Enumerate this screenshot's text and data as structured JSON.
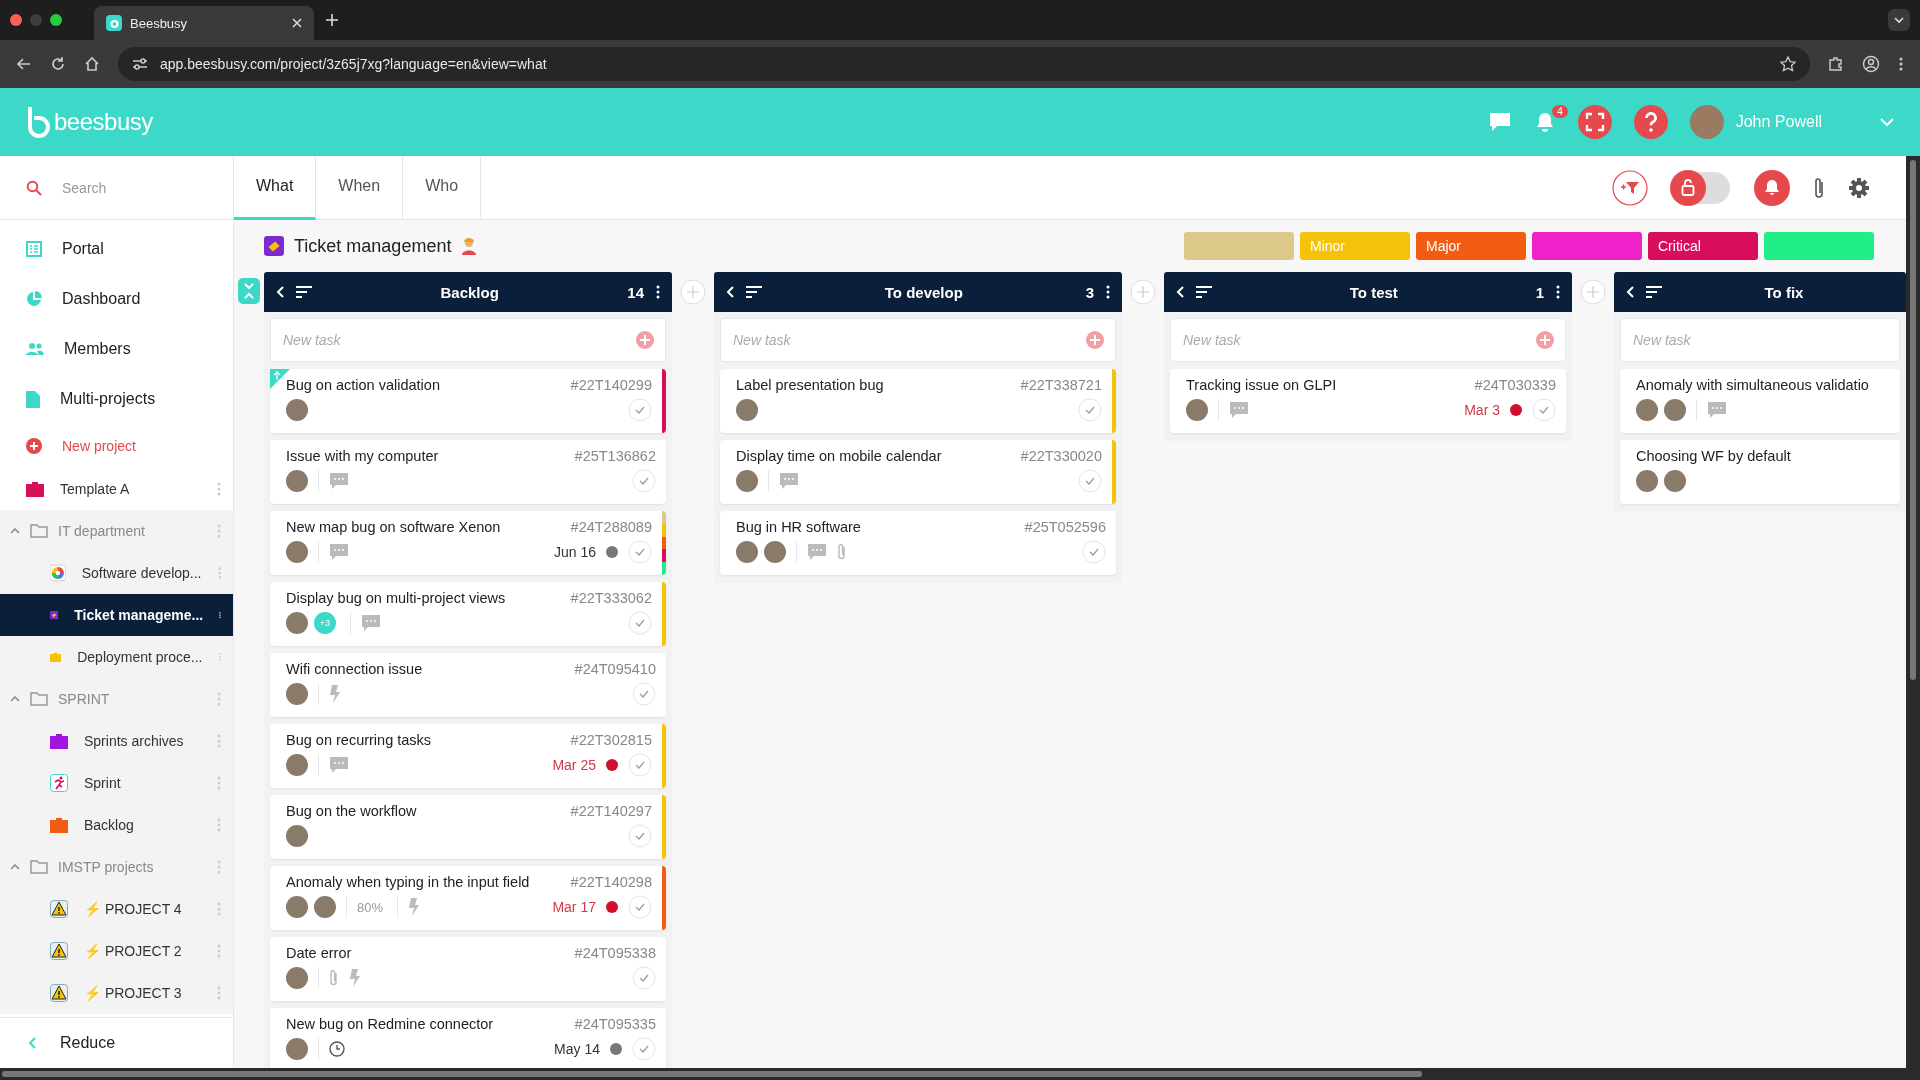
{
  "browser": {
    "tab_title": "Beesbusy",
    "url": "app.beesbusy.com/project/3z65j7xg?language=en&view=what"
  },
  "header": {
    "logo": "beesbusy",
    "notification_count": "4",
    "user_name": "John Powell"
  },
  "sidebar": {
    "search": {
      "placeholder": "Search"
    },
    "nav": [
      {
        "label": "Portal",
        "kind": "portal"
      },
      {
        "label": "Dashboard",
        "kind": "dashboard"
      },
      {
        "label": "Members",
        "kind": "members"
      },
      {
        "label": "Multi-projects",
        "kind": "multi"
      },
      {
        "label": "New project",
        "kind": "new"
      }
    ],
    "tree": [
      {
        "kind": "project",
        "label": "Template A",
        "color": "#d6105a",
        "selected": false
      },
      {
        "kind": "group",
        "label": "IT department",
        "expanded": true,
        "children": [
          {
            "label": "Software develop...",
            "kind": "wheel",
            "selected": false
          },
          {
            "label": "Ticket manageme...",
            "kind": "ticket",
            "selected": true
          },
          {
            "label": "Deployment proce...",
            "kind": "briefcase",
            "color": "#f5c20b",
            "selected": false
          }
        ]
      },
      {
        "kind": "group",
        "label": "SPRINT",
        "expanded": true,
        "children": [
          {
            "label": "Sprints archives",
            "kind": "briefcase",
            "color": "#a314e0",
            "selected": false
          },
          {
            "label": "Sprint",
            "kind": "runner",
            "selected": false
          },
          {
            "label": "Backlog",
            "kind": "briefcase",
            "color": "#f25c12",
            "selected": false
          }
        ]
      },
      {
        "kind": "group",
        "label": "IMSTP projects",
        "expanded": true,
        "children": [
          {
            "label": "⚡ PROJECT 4",
            "kind": "warning",
            "selected": false
          },
          {
            "label": "⚡ PROJECT 2",
            "kind": "warning",
            "selected": false
          },
          {
            "label": "⚡ PROJECT 3",
            "kind": "warning",
            "selected": false
          }
        ]
      }
    ],
    "reduce": "Reduce"
  },
  "view_tabs": [
    {
      "label": "What",
      "selected": true
    },
    {
      "label": "When",
      "selected": false
    },
    {
      "label": "Who",
      "selected": false
    }
  ],
  "board": {
    "title": "Ticket management"
  },
  "labels": [
    {
      "color": "#dcc98a"
    },
    {
      "text": "Minor",
      "color": "#f5c20b"
    },
    {
      "text": "Major",
      "color": "#f25c12"
    },
    {
      "color": "#ee22c8"
    },
    {
      "text": "Critical",
      "color": "#d80d5b"
    },
    {
      "color": "#22ee88"
    }
  ],
  "columns": [
    {
      "title": "Backlog",
      "count": "14",
      "placeholder": "New task",
      "tasks": [
        {
          "title": "Bug on action validation",
          "id": "#22T140299",
          "flagged": true,
          "avatars": [
            {
              "kind": "person"
            }
          ],
          "stripes": [
            {
              "color": "#d80d5b"
            }
          ]
        },
        {
          "title": "Issue with my computer",
          "id": "#25T136862",
          "avatars": [
            {
              "kind": "person"
            }
          ],
          "icons": [
            {
              "kind": "comment"
            }
          ]
        },
        {
          "title": "New map bug on software Xenon",
          "id": "#24T288089",
          "avatars": [
            {
              "kind": "person"
            }
          ],
          "icons": [
            {
              "kind": "comment"
            }
          ],
          "due": "Jun 16",
          "overdue": false,
          "stripes": [
            {
              "color": "#dcc98a"
            },
            {
              "color": "#f5c20b"
            },
            {
              "color": "#f25c12"
            },
            {
              "color": "#d80d5b"
            },
            {
              "color": "#22ee88"
            }
          ]
        },
        {
          "title": "Display bug on multi-project views",
          "id": "#22T333062",
          "avatars": [
            {
              "kind": "person"
            },
            {
              "kind": "more",
              "text": "+3"
            }
          ],
          "icons": [
            {
              "kind": "comment"
            }
          ],
          "stripes": [
            {
              "color": "#f5c20b"
            }
          ]
        },
        {
          "title": "Wifi connection issue",
          "id": "#24T095410",
          "avatars": [
            {
              "kind": "person"
            }
          ],
          "icons": [
            {
              "kind": "bolt"
            }
          ]
        },
        {
          "title": "Bug on recurring tasks",
          "id": "#22T302815",
          "avatars": [
            {
              "kind": "person"
            }
          ],
          "icons": [
            {
              "kind": "comment"
            }
          ],
          "due": "Mar 25",
          "overdue": true,
          "stripes": [
            {
              "color": "#f5c20b"
            }
          ]
        },
        {
          "title": "Bug on the workflow",
          "id": "#22T140297",
          "avatars": [
            {
              "kind": "person"
            }
          ],
          "stripes": [
            {
              "color": "#f5c20b"
            }
          ]
        },
        {
          "title": "Anomaly when typing in the input field",
          "id": "#22T140298",
          "avatars": [
            {
              "kind": "person"
            },
            {
              "kind": "person"
            }
          ],
          "progress": "80%",
          "icons": [
            {
              "kind": "bolt"
            }
          ],
          "due": "Mar 17",
          "overdue": true,
          "stripes": [
            {
              "color": "#f25c12"
            }
          ]
        },
        {
          "title": "Date error",
          "id": "#24T095338",
          "avatars": [
            {
              "kind": "person"
            }
          ],
          "icons": [
            {
              "kind": "attachment"
            },
            {
              "kind": "bolt"
            }
          ]
        },
        {
          "title": "New bug on Redmine connector",
          "id": "#24T095335",
          "avatars": [
            {
              "kind": "person"
            }
          ],
          "icons": [
            {
              "kind": "clock"
            }
          ],
          "due": "May 14",
          "overdue": false
        }
      ]
    },
    {
      "title": "To develop",
      "count": "3",
      "placeholder": "New task",
      "tasks": [
        {
          "title": "Label presentation bug",
          "id": "#22T338721",
          "avatars": [
            {
              "kind": "person"
            }
          ],
          "stripes": [
            {
              "color": "#f5c20b"
            }
          ]
        },
        {
          "title": "Display time on mobile calendar",
          "id": "#22T330020",
          "avatars": [
            {
              "kind": "person"
            }
          ],
          "icons": [
            {
              "kind": "comment"
            }
          ],
          "stripes": [
            {
              "color": "#f5c20b"
            }
          ]
        },
        {
          "title": "Bug in HR software",
          "id": "#25T052596",
          "avatars": [
            {
              "kind": "person"
            },
            {
              "kind": "person"
            }
          ],
          "icons": [
            {
              "kind": "comment"
            },
            {
              "kind": "attachment"
            }
          ]
        }
      ]
    },
    {
      "title": "To test",
      "count": "1",
      "placeholder": "New task",
      "tasks": [
        {
          "title": "Tracking issue on GLPI",
          "id": "#24T030339",
          "avatars": [
            {
              "kind": "person"
            }
          ],
          "icons": [
            {
              "kind": "comment"
            }
          ],
          "due": "Mar 3",
          "overdue": true
        }
      ]
    },
    {
      "title": "To fix",
      "placeholder": "New task",
      "tasks": [
        {
          "title": "Anomaly with simultaneous validatio",
          "avatars": [
            {
              "kind": "person"
            },
            {
              "kind": "person"
            }
          ],
          "icons": [
            {
              "kind": "comment"
            }
          ]
        },
        {
          "title": "Choosing WF by default",
          "avatars": [
            {
              "kind": "person"
            },
            {
              "kind": "person"
            }
          ]
        }
      ]
    }
  ]
}
